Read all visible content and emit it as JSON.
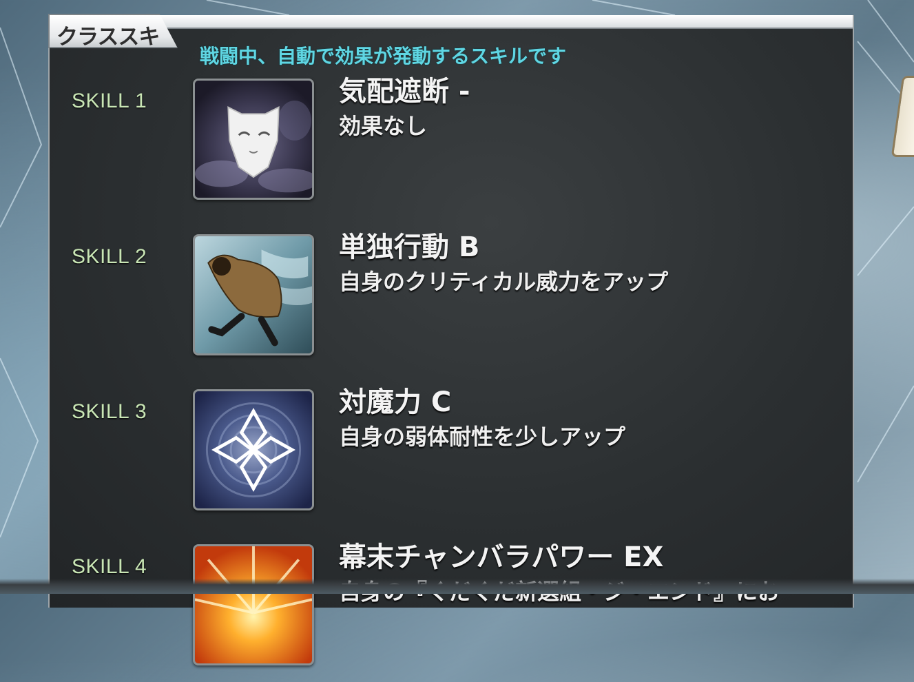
{
  "panel": {
    "tab_label": "クラススキル",
    "subtitle": "戦闘中、自動で効果が発動するスキルです"
  },
  "skills": [
    {
      "label": "SKILL 1",
      "name": "気配遮断 -",
      "description": "効果なし",
      "icon": "white-mask-smoke-icon"
    },
    {
      "label": "SKILL 2",
      "name": "単独行動 B",
      "description": "自身のクリティカル威力をアップ",
      "icon": "cloaked-runner-icon"
    },
    {
      "label": "SKILL 3",
      "name": "対魔力 C",
      "description": "自身の弱体耐性を少しアップ",
      "icon": "four-diamond-swirl-icon"
    },
    {
      "label": "SKILL 4",
      "name": "幕末チャンバラパワー EX",
      "description": "自身の『ぐだぐだ新選組・ジ・エンド』にお",
      "icon": "orange-burst-icon"
    }
  ],
  "colors": {
    "subtitle": "#5fd6e3",
    "skill_label": "#c9e6b5",
    "panel_bg": "#2f3335",
    "text": "#f4f4f4"
  }
}
